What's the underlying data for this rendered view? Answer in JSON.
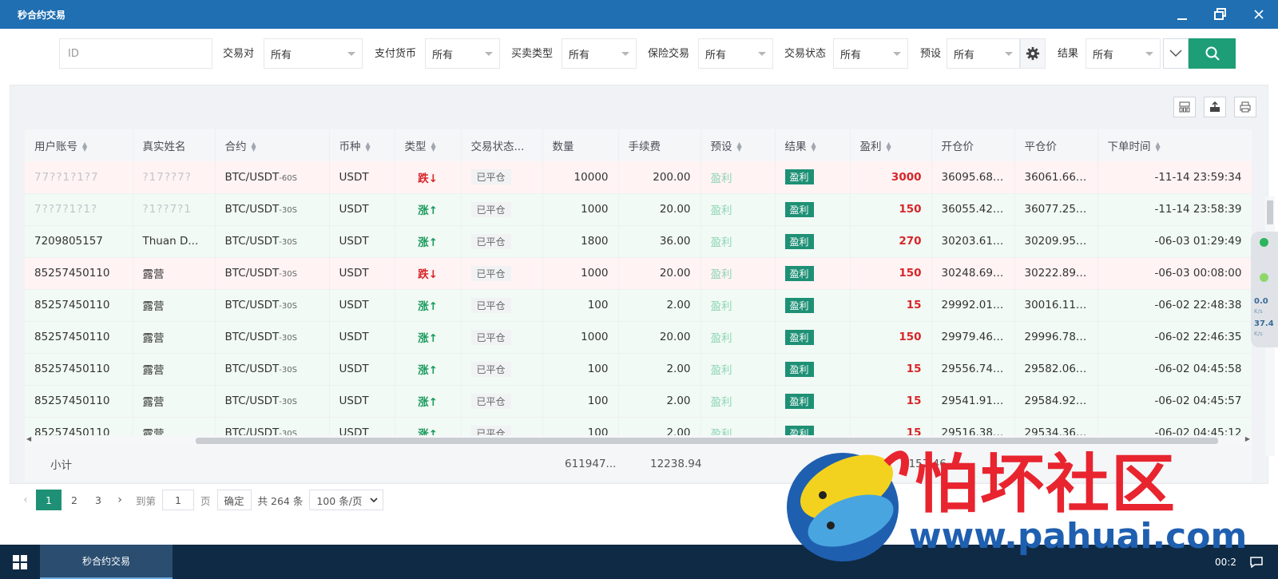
{
  "window": {
    "title": "秒合约交易",
    "controls": [
      "—",
      "❐",
      "✕"
    ]
  },
  "filters": {
    "id_placeholder": "ID",
    "items": [
      {
        "label": "交易对",
        "value": "所有"
      },
      {
        "label": "支付货币",
        "value": "所有"
      },
      {
        "label": "买卖类型",
        "value": "所有"
      },
      {
        "label": "保险交易",
        "value": "所有"
      },
      {
        "label": "交易状态",
        "value": "所有"
      },
      {
        "label": "预设",
        "value": "所有"
      },
      {
        "label": "结果",
        "value": "所有"
      }
    ]
  },
  "table": {
    "columns": [
      "用户账号",
      "真实姓名",
      "合约",
      "币种",
      "类型",
      "交易状态...",
      "数量",
      "手续费",
      "预设",
      "结果",
      "盈利",
      "开仓价",
      "平仓价",
      "下单时间"
    ],
    "rows": [
      {
        "dir": "down",
        "account": "77??1?1?7",
        "name": "?17??7?",
        "contract": "BTC/USDT",
        "period": "-60S",
        "coin": "USDT",
        "type": "跌↓",
        "status": "已平仓",
        "qty": "10000",
        "fee": "200.00",
        "preset": "盈利",
        "result": "盈利",
        "profit": "3000",
        "open": "36095.6826",
        "close": "36061.6695",
        "time": "-11-14 23:59:34"
      },
      {
        "dir": "up",
        "account": "7??7?1?1?",
        "name": "?1??7?1",
        "contract": "BTC/USDT",
        "period": "-30S",
        "coin": "USDT",
        "type": "涨↑",
        "status": "已平仓",
        "qty": "1000",
        "fee": "20.00",
        "preset": "盈利",
        "result": "盈利",
        "profit": "150",
        "open": "36055.4201",
        "close": "36077.2546",
        "time": "-11-14 23:58:39"
      },
      {
        "dir": "up",
        "account": "7209805157",
        "name": "Thuan D...",
        "contract": "BTC/USDT",
        "period": "-30S",
        "coin": "USDT",
        "type": "涨↑",
        "status": "已平仓",
        "qty": "1800",
        "fee": "36.00",
        "preset": "盈利",
        "result": "盈利",
        "profit": "270",
        "open": "30203.6194",
        "close": "30209.9534",
        "time": "-06-03 01:29:49"
      },
      {
        "dir": "down",
        "account": "85257450110",
        "name": "露营",
        "contract": "BTC/USDT",
        "period": "-30S",
        "coin": "USDT",
        "type": "跌↓",
        "status": "已平仓",
        "qty": "1000",
        "fee": "20.00",
        "preset": "盈利",
        "result": "盈利",
        "profit": "150",
        "open": "30248.6906",
        "close": "30222.8967",
        "time": "-06-03 00:08:00"
      },
      {
        "dir": "up",
        "account": "85257450110",
        "name": "露营",
        "contract": "BTC/USDT",
        "period": "-30S",
        "coin": "USDT",
        "type": "涨↑",
        "status": "已平仓",
        "qty": "100",
        "fee": "2.00",
        "preset": "盈利",
        "result": "盈利",
        "profit": "15",
        "open": "29992.0193",
        "close": "30016.1112",
        "time": "-06-02 22:48:38"
      },
      {
        "dir": "up",
        "account": "85257450110",
        "name": "露营",
        "contract": "BTC/USDT",
        "period": "-30S",
        "coin": "USDT",
        "type": "涨↑",
        "status": "已平仓",
        "qty": "1000",
        "fee": "20.00",
        "preset": "盈利",
        "result": "盈利",
        "profit": "150",
        "open": "29979.4660",
        "close": "29996.7856",
        "time": "-06-02 22:46:35"
      },
      {
        "dir": "up",
        "account": "85257450110",
        "name": "露营",
        "contract": "BTC/USDT",
        "period": "-30S",
        "coin": "USDT",
        "type": "涨↑",
        "status": "已平仓",
        "qty": "100",
        "fee": "2.00",
        "preset": "盈利",
        "result": "盈利",
        "profit": "15",
        "open": "29556.7414",
        "close": "29582.0639",
        "time": "-06-02 04:45:58"
      },
      {
        "dir": "up",
        "account": "85257450110",
        "name": "露营",
        "contract": "BTC/USDT",
        "period": "-30S",
        "coin": "USDT",
        "type": "涨↑",
        "status": "已平仓",
        "qty": "100",
        "fee": "2.00",
        "preset": "盈利",
        "result": "盈利",
        "profit": "15",
        "open": "29541.9137",
        "close": "29584.9217",
        "time": "-06-02 04:45:57"
      },
      {
        "dir": "up",
        "account": "85257450110",
        "name": "露营",
        "contract": "BTC/USDT",
        "period": "-30S",
        "coin": "USDT",
        "type": "涨↑",
        "status": "已平仓",
        "qty": "100",
        "fee": "2.00",
        "preset": "盈利",
        "result": "盈利",
        "profit": "15",
        "open": "29516.3838",
        "close": "29534.3669",
        "time": "-06-02 04:45:12"
      }
    ],
    "subtotal": {
      "label": "小计",
      "qty": "611947...",
      "fee": "12238.94",
      "profit": "8157.46"
    }
  },
  "pager": {
    "pages": [
      "1",
      "2",
      "3"
    ],
    "goto_label": "到第",
    "goto_value": "1",
    "page_unit": "页",
    "confirm": "确定",
    "total": "共 264 条",
    "page_size": "100 条/页"
  },
  "taskbar": {
    "item": "秒合约交易",
    "clock": "00:2"
  },
  "net_widget": {
    "v1": "0.0",
    "v2": "37.4",
    "unit": "K/s"
  },
  "watermark": {
    "title": "怕坏社区",
    "url": "www.pahuai.com"
  },
  "colors": {
    "accent": "#1e9075",
    "titlebar": "#1f6fb2",
    "up": "#1a9a5e",
    "down": "#d7262b"
  }
}
